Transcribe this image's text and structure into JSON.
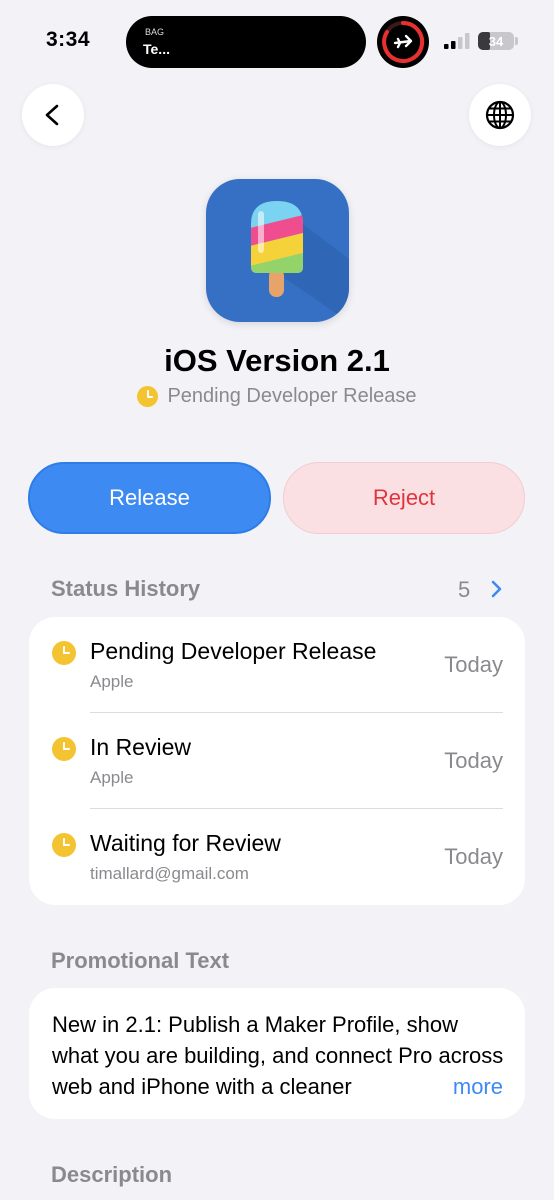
{
  "status_bar": {
    "time": "3:34",
    "island_label_small": "BAG",
    "island_label_big": "Te...",
    "battery_level": "34"
  },
  "nav": {
    "back_icon": "chevron-left-icon",
    "globe_icon": "globe-icon"
  },
  "app": {
    "title": "iOS Version 2.1",
    "status": "Pending Developer Release",
    "icon": "popsicle-app-icon"
  },
  "actions": {
    "release_label": "Release",
    "reject_label": "Reject"
  },
  "status_history": {
    "header": "Status History",
    "count": "5",
    "items": [
      {
        "title": "Pending Developer Release",
        "subtitle": "Apple",
        "date": "Today"
      },
      {
        "title": "In Review",
        "subtitle": "Apple",
        "date": "Today"
      },
      {
        "title": "Waiting for Review",
        "subtitle": "timallard@gmail.com",
        "date": "Today"
      }
    ]
  },
  "promotional": {
    "header": "Promotional Text",
    "text": "New in 2.1: Publish a Maker Profile, show what you are building, and connect Pro across web and iPhone with a cleaner",
    "more_label": "more"
  },
  "description": {
    "header": "Description"
  },
  "colors": {
    "accent": "#3d8bf2",
    "reject": "#e0343d",
    "pending": "#f4c430",
    "background": "#f2f2f7"
  }
}
